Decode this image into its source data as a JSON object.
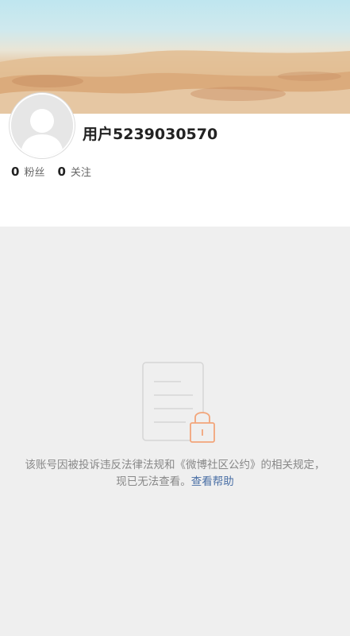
{
  "profile": {
    "username": "用户5239030570",
    "stats": [
      {
        "count": "0",
        "label": "粉丝"
      },
      {
        "count": "0",
        "label": "关注"
      }
    ]
  },
  "notice": {
    "message": "该账号因被投诉违反法律法规和《微博社区公约》的相关规定，现已无法查看。",
    "help_link": "查看帮助",
    "icon": "locked-document-icon"
  },
  "colors": {
    "background": "#efefef",
    "card": "#ffffff",
    "link": "#4a6fa5",
    "lock": "#f2a57a"
  }
}
